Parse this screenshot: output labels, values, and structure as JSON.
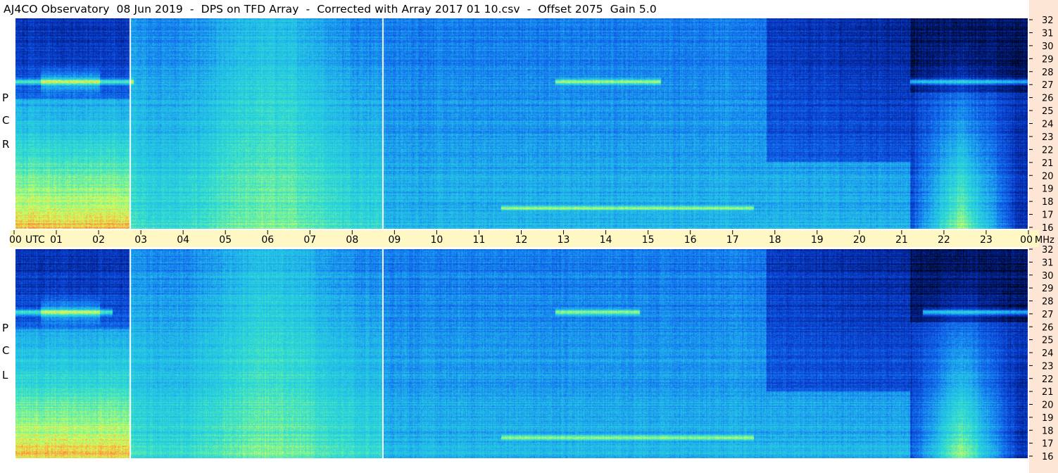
{
  "title": "AJ4CO Observatory  08 Jun 2019  -  DPS on TFD Array  -  Corrected with Array 2017 01 10.csv  -  Offset 2075  Gain 5.0",
  "colors": {
    "background": "#ffffff",
    "time_band": "#fff8c4",
    "freq_strip": "#fde6d6",
    "data_gap_line": "#ffffff"
  },
  "chart_data": {
    "type": "heatmap",
    "title": "AJ4CO Observatory  08 Jun 2019  -  DPS on TFD Array  -  Corrected with Array 2017 01 10.csv  -  Offset 2075  Gain 5.0",
    "x_axis": {
      "label": "UTC",
      "range": [
        "00",
        "00"
      ],
      "tick_labels": [
        "00",
        "01",
        "02",
        "03",
        "04",
        "05",
        "06",
        "07",
        "08",
        "09",
        "10",
        "11",
        "12",
        "13",
        "14",
        "15",
        "16",
        "17",
        "18",
        "19",
        "20",
        "21",
        "22",
        "23",
        "00"
      ]
    },
    "y_axis": {
      "label": "MHz",
      "range": [
        16,
        32
      ],
      "tick_labels": [
        "32",
        "31",
        "30",
        "29",
        "28",
        "27",
        "26",
        "25",
        "24",
        "23",
        "22",
        "21",
        "20",
        "19",
        "18",
        "17",
        "16"
      ]
    },
    "panels": [
      {
        "name": "R C P",
        "letters": [
          "R",
          "C",
          "P"
        ]
      },
      {
        "name": "L C P",
        "letters": [
          "L",
          "C",
          "P"
        ]
      }
    ],
    "gaps_utc_hours": [
      2.72,
      8.72
    ],
    "colormap": [
      "#000000",
      "#001a7a",
      "#0a3ed0",
      "#1477f0",
      "#22b7ea",
      "#2ad8d8",
      "#6ef0a0",
      "#d8ff5a",
      "#ff9a3a",
      "#ff3060"
    ]
  }
}
